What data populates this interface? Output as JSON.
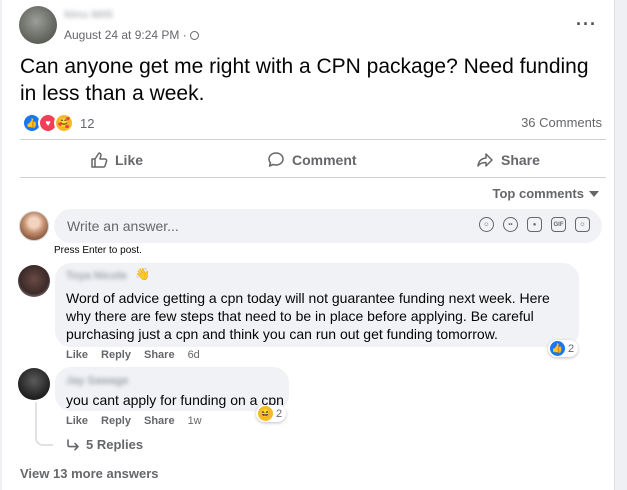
{
  "post": {
    "author": "Ninu Milli",
    "timestamp": "August 24 at 9:24 PM ·",
    "text": "Can anyone get me right with a CPN package? Need funding in less than a week.",
    "reaction_count": "12",
    "comments_count": "36 Comments"
  },
  "actions": {
    "like": "Like",
    "comment": "Comment",
    "share": "Share"
  },
  "sort": {
    "label": "Top comments"
  },
  "composer": {
    "placeholder": "Write an answer...",
    "hint": "Press Enter to post."
  },
  "comments": [
    {
      "author": "Toya Nicole",
      "text": "Word of advice getting a cpn today will not guarantee funding next week. Here why there are few steps that need to be in place before applying. Be careful purchasing just a cpn and think you can run out get funding tomorrow.",
      "like": "Like",
      "reply": "Reply",
      "share": "Share",
      "time": "6d",
      "reaction_count": "2"
    },
    {
      "author": "Jay Sawage",
      "text": "you cant apply for funding on a cpn",
      "like": "Like",
      "reply": "Reply",
      "share": "Share",
      "time": "1w",
      "reaction_count": "2",
      "replies_label": "5 Replies"
    }
  ],
  "view_more": "View 13 more answers",
  "colors": {
    "accent_blue": "#1877f2",
    "love_red": "#f33e58",
    "secondary_text": "#65676b",
    "bubble_gray": "#f0f2f5"
  },
  "icons": [
    "globe-icon",
    "more-options-icon",
    "like-reaction-icon",
    "love-reaction-icon",
    "care-reaction-icon",
    "thumbs-up-icon",
    "comment-icon",
    "share-arrow-icon",
    "caret-down-icon",
    "avatar-sticker-icon",
    "emoji-icon",
    "camera-icon",
    "gif-icon",
    "sticker-icon",
    "wave-badge-icon",
    "haha-reaction-icon",
    "reply-arrow-icon"
  ]
}
